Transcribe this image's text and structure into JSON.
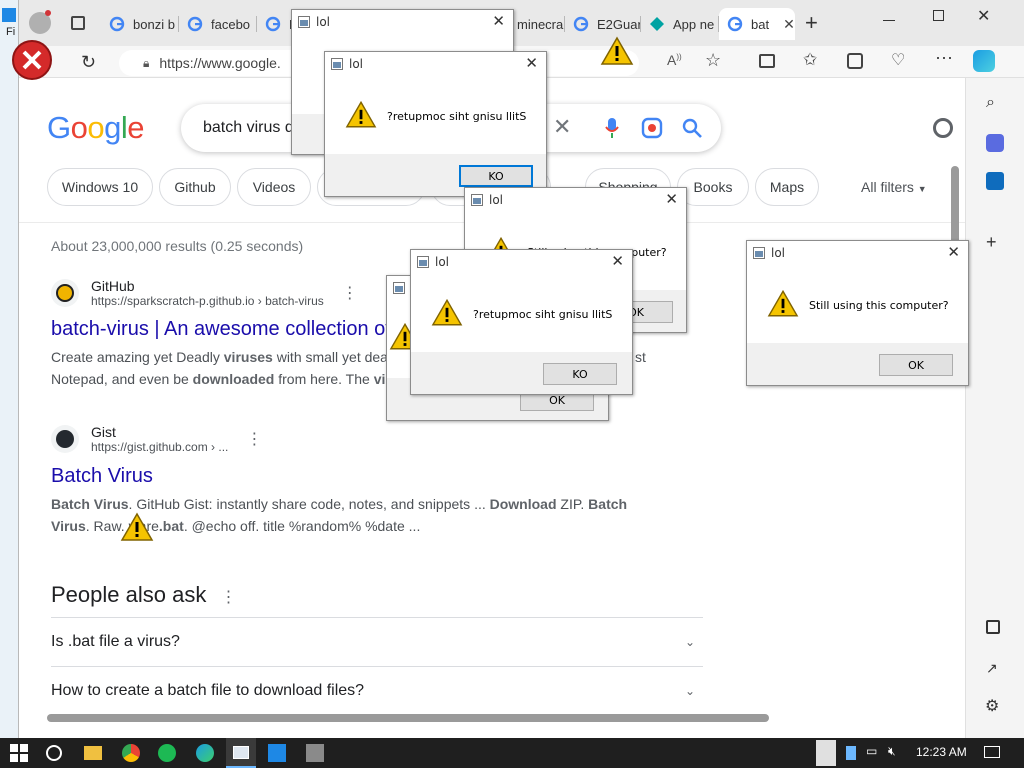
{
  "window": {
    "left_edge_letters": "Fi"
  },
  "tabs": [
    {
      "label": "bonzi b",
      "favicon": "google"
    },
    {
      "label": "facebo",
      "favicon": "google"
    },
    {
      "label": "H",
      "favicon": "google"
    },
    {
      "label": "minecra",
      "favicon": "none"
    },
    {
      "label": "E2Guar",
      "favicon": "google"
    },
    {
      "label": "App ne",
      "favicon": "app"
    },
    {
      "label": "bat",
      "favicon": "google",
      "active": true
    }
  ],
  "address": {
    "url": "https://www.google."
  },
  "google": {
    "logo": "Google",
    "query": "batch virus d",
    "filters": [
      "Windows 10",
      "Github",
      "Videos",
      "",
      "",
      "Shopping",
      "Books",
      "Maps"
    ],
    "all_filters": "All filters",
    "stats": "About 23,000,000 results (0.25 seconds)",
    "results": [
      {
        "site": "GitHub",
        "url": "https://sparkscratch-p.github.io › batch-virus",
        "title": "batch-virus | An awesome collection of",
        "snippet_parts": [
          "Create amazing yet Deadly ",
          "viruses",
          " with small yet dea",
          "Notepad, and even be ",
          "downloaded",
          " from here. The ",
          "vi"
        ],
        "snippet_tail": "st"
      },
      {
        "site": "Gist",
        "url": "https://gist.github.com › ...",
        "title": "Batch Virus",
        "snippet_parts": [
          "Batch Virus",
          ". GitHub Gist: instantly share code, notes, and snippets ... ",
          "Download",
          " ZIP. ",
          "Batch",
          "Virus",
          ". Raw. ",
          "ware",
          ".bat",
          ". @echo off. title %random% %date ..."
        ]
      }
    ],
    "people_also_ask": {
      "heading": "People also ask",
      "questions": [
        "Is .bat file a virus?",
        "How to create a batch file to download files?"
      ]
    }
  },
  "dialogs": [
    {
      "id": "d1",
      "title": "lol",
      "message": "",
      "ok": ""
    },
    {
      "id": "d2",
      "title": "lol",
      "message": "?retupmoc siht gnisu llitS",
      "ok": "KO"
    },
    {
      "id": "d3",
      "title": "lol",
      "message": "Still using this computer?",
      "ok": "OK"
    },
    {
      "id": "d4",
      "title": "lol",
      "message": "",
      "ok": "OK"
    },
    {
      "id": "d5",
      "title": "lol",
      "message": "?retupmoc siht gnisu llitS",
      "ok": "KO"
    },
    {
      "id": "d6",
      "title": "lol",
      "message": "Still using this computer?",
      "ok": "OK"
    }
  ],
  "taskbar": {
    "time": "12:23 AM"
  },
  "colors": {
    "link": "#1a0dab",
    "google_blue": "#4285f4",
    "google_red": "#ea4335",
    "google_yellow": "#fbbc05",
    "google_green": "#34a853",
    "warning": "#f5c400"
  }
}
